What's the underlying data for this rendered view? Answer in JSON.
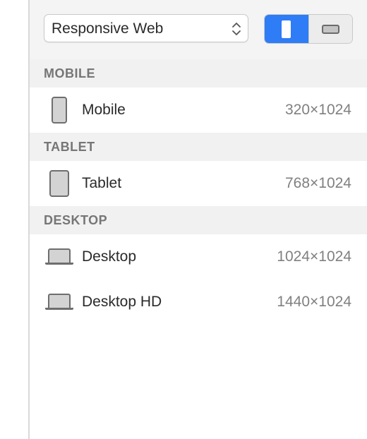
{
  "toolbar": {
    "preset_select": {
      "value": "Responsive Web",
      "chevron_icon": "up-down-chevron-icon"
    },
    "orientation": {
      "selected": "portrait",
      "portrait_icon": "portrait-icon",
      "landscape_icon": "landscape-icon",
      "accent_color": "#2e7cf6"
    }
  },
  "sections": {
    "mobile": {
      "title": "MOBILE",
      "devices": [
        {
          "name": "Mobile",
          "size": "320×1024",
          "icon": "phone-icon"
        }
      ]
    },
    "tablet": {
      "title": "TABLET",
      "devices": [
        {
          "name": "Tablet",
          "size": "768×1024",
          "icon": "tablet-icon"
        }
      ]
    },
    "desktop": {
      "title": "DESKTOP",
      "devices": [
        {
          "name": "Desktop",
          "size": "1024×1024",
          "icon": "laptop-icon"
        },
        {
          "name": "Desktop HD",
          "size": "1440×1024",
          "icon": "laptop-icon"
        }
      ]
    }
  }
}
